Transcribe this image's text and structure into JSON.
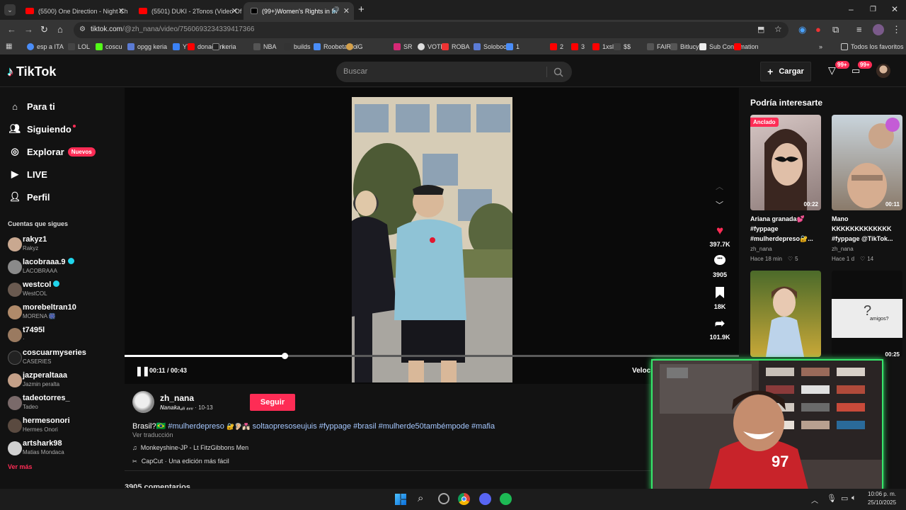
{
  "browser": {
    "tabs": [
      {
        "title": "(5500) One Direction - Night Ch",
        "icon": "youtube-icon"
      },
      {
        "title": "(5501) DUKI - 2Tonos (Video Of",
        "icon": "youtube-icon"
      },
      {
        "title": "(99+)Women's Rights in Br",
        "icon": "tiktok-icon",
        "active": true
      }
    ],
    "url_host": "tiktok.com",
    "url_path": "/@zh_nana/video/7560693234339417366",
    "bookmarks": [
      "esp a ITA",
      "LOL",
      "coscu",
      "opgg keria",
      "YT",
      "donacion",
      "keria",
      "NBA",
      "builds",
      "Roobetardo",
      "IG",
      "SR",
      "VOTE",
      "ROBA",
      "Soloboom",
      "1",
      "2",
      "3",
      "1xslot",
      "$$",
      "FAIR",
      "Bitlucy",
      "Sub Confirmation"
    ],
    "all_bookmarks": "Todos los favoritos"
  },
  "header": {
    "logo": "TikTok",
    "search_placeholder": "Buscar",
    "upload_label": "Cargar",
    "notif_badge_1": "99+",
    "notif_badge_2": "99+"
  },
  "sidebar": {
    "nav": {
      "para_ti": "Para ti",
      "siguiendo": "Siguiendo",
      "explorar": "Explorar",
      "explorar_badge": "Nuevos",
      "live": "LIVE",
      "perfil": "Perfil"
    },
    "following_title": "Cuentas que sigues",
    "accounts": [
      {
        "user": "rakyz1",
        "name": "Rakyz",
        "verified": false
      },
      {
        "user": "lacobraaa.9",
        "name": "LACOBRAAA",
        "verified": true
      },
      {
        "user": "westcol",
        "name": "WestCOL",
        "verified": true
      },
      {
        "user": "morebeltran10",
        "name": "MORENA 🎆",
        "verified": false
      },
      {
        "user": "t7495l",
        "name": "·",
        "verified": false
      },
      {
        "user": "coscuarmyseries",
        "name": "CASERIES",
        "verified": false
      },
      {
        "user": "jazperaltaaa",
        "name": "Jazmin peralta",
        "verified": false
      },
      {
        "user": "tadeotorres_",
        "name": "Tadeo",
        "verified": false
      },
      {
        "user": "hermesonori",
        "name": "Hermes Onori",
        "verified": false
      },
      {
        "user": "artshark98",
        "name": "Matias Mondaca",
        "verified": false
      }
    ],
    "see_more": "Ver más"
  },
  "player": {
    "time": "00:11 / 00:43",
    "progress": 0.26,
    "speed_label": "Veloc"
  },
  "actions": {
    "likes": "397.7K",
    "comments": "3905",
    "saves": "18K",
    "shares": "101.9K"
  },
  "post": {
    "username": "zh_nana",
    "display_name": "Nanaka꜀ᵢᵢᵢ ₐᵥᵥ",
    "date": "10-13",
    "follow_label": "Seguir",
    "caption_prefix": "Brasil?🇧🇷",
    "hashtags_1": "#mulherdepreso",
    "emoji_mid": "🔐🦻🏻👩🏻‍❤️‍💋‍👨🏻",
    "hashtags_2": "soltaopresoseujuis #fyppage #brasil #mulherde50tambémpode #mafia",
    "translate": "Ver traducción",
    "music": "Monkeyshine-JP - Lt FitzGibbons Men",
    "capcut": "CapCut · Una edición más fácil",
    "comments_peek": "3905 comentarios"
  },
  "recommendations": {
    "title": "Podría interesarte",
    "items": [
      {
        "badge": "Anclado",
        "duration": "00:22",
        "title": "Ariana granada💕 #fyppage #mulherdepreso🔐...",
        "author": "zh_nana",
        "time": "Hace 18 min",
        "likes": "5"
      },
      {
        "badge": "",
        "duration": "00:11",
        "title": "Mano KKKKKKKKKKKKK #fyppage @TikTok...",
        "author": "zh_nana",
        "time": "Hace 1 d",
        "likes": "14"
      },
      {
        "badge": "",
        "duration": "",
        "title": "",
        "author": "",
        "time": "",
        "likes": ""
      },
      {
        "badge": "",
        "duration": "00:25",
        "title": "amigos?",
        "author": "",
        "time": "",
        "likes": ""
      }
    ]
  },
  "taskbar": {
    "time": "10:06 p. m.",
    "date": "25/10/2025"
  },
  "colors": {
    "brand_red": "#fe2c55",
    "hashtag_blue": "#a6c8ff",
    "streamer_green": "#37e66b"
  }
}
